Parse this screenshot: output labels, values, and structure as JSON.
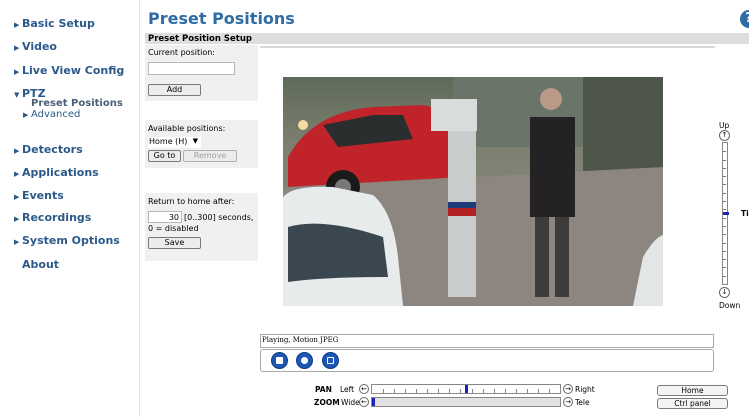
{
  "sidebar": {
    "items": [
      {
        "label": "Basic Setup"
      },
      {
        "label": "Video"
      },
      {
        "label": "Live View Config"
      },
      {
        "label": "PTZ"
      },
      {
        "label": "Detectors"
      },
      {
        "label": "Applications"
      },
      {
        "label": "Events"
      },
      {
        "label": "Recordings"
      },
      {
        "label": "System Options"
      },
      {
        "label": "About"
      }
    ],
    "ptz_sub": [
      {
        "label": "Preset Positions"
      },
      {
        "label": "Advanced"
      }
    ]
  },
  "header": {
    "title": "Preset Positions",
    "help_icon": "?"
  },
  "section": {
    "title": "Preset Position Setup"
  },
  "current": {
    "label": "Current position:",
    "value": "",
    "add_label": "Add"
  },
  "available": {
    "label": "Available positions:",
    "selected": "Home (H)",
    "goto_label": "Go to",
    "remove_label": "Remove"
  },
  "return_home": {
    "label": "Return to home after:",
    "seconds": "30",
    "range_text": "[0..300] seconds,",
    "disabled_note": "0 = disabled",
    "save_label": "Save"
  },
  "tilt": {
    "up_label": "Up",
    "down_label": "Down",
    "label": "Ti",
    "level": 0.5
  },
  "status": {
    "text": "Playing, Motion JPEG"
  },
  "controls": {
    "icons": [
      "stop-icon",
      "snapshot-icon",
      "fullscreen-icon"
    ]
  },
  "pan": {
    "label": "PAN",
    "left": "Left",
    "right": "Right",
    "level": 0.5
  },
  "zoom": {
    "label": "ZOOM",
    "wide": "Wide",
    "tele": "Tele",
    "level": 0.0
  },
  "right_buttons": {
    "home_label": "Home",
    "ctrl_label": "Ctrl panel"
  },
  "colors": {
    "nav": "#2b5a8a",
    "title": "#2f6ca3",
    "marker": "#1b22b5"
  }
}
